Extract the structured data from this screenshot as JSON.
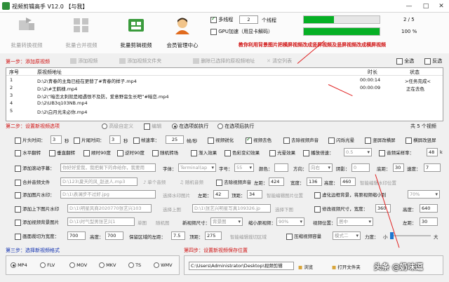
{
  "window": {
    "title": "视频剪辑高手 V12.0 【与我】",
    "minimize": "—",
    "maximize": "□",
    "close": "✕"
  },
  "toolbar": {
    "buttons": [
      "批量转换视频",
      "批量合并视频",
      "批量剪辑视频",
      "会员管理中心"
    ]
  },
  "threads": {
    "multi_label": "多线程",
    "count": "2",
    "unit": "个线程",
    "gpu_label": "GPU加速（用显卡解码）",
    "progress1": {
      "fraction": 0.4,
      "text": "2 / 5"
    },
    "progress2": {
      "fraction": 1.0,
      "text": "100 %"
    }
  },
  "banner": "教你利用背景图片把横屏视频改成竖屏视频及竖屏视频改成横屏视频",
  "step1": {
    "title": "第一步：添加原视频",
    "add_video": "添加视频",
    "add_folder": "添加视频文件夹",
    "remove_selected": "删除已选择的原视频地址",
    "clear_list": "清空列表",
    "select_all": "全选",
    "invert": "反选"
  },
  "table": {
    "headers": [
      "序号",
      "原视频地址",
      "时长",
      "状态"
    ],
    "rows": [
      {
        "no": "1",
        "path": "D:\\2\\青春的主角已经在更替了#青春的样子.mp4",
        "duration": "00:00:14",
        "status": ">任务完成<"
      },
      {
        "no": "2",
        "path": "D:\\2\\#王鹤棣.mp4",
        "duration": "00:00:09",
        "status": "正在去色"
      },
      {
        "no": "3",
        "path": "D:\\2\\“暗恋太刺就是相遇恨不及防，爱意野蛮生长吧”#暗恋.mp4",
        "duration": "",
        "status": ""
      },
      {
        "no": "4",
        "path": "D:\\2\\UB3q103NB.mp4",
        "duration": "",
        "status": ""
      },
      {
        "no": "5",
        "path": "D:\\2\\白月光未必你.mp4",
        "duration": "",
        "status": ""
      }
    ]
  },
  "step2": {
    "title": "第二步：设置新视频选项",
    "advanced": "高级自定义",
    "edit": "编辑",
    "parallel": "在选项前执行",
    "after": "在选项后执行",
    "total": "共 5 个视频"
  },
  "options": {
    "r1": {
      "head_cut": "片头时间：",
      "head_val": "3",
      "sec1": "秒",
      "tail_cut": "片尾时间：",
      "tail_val": "3",
      "sec2": "秒",
      "fps_label": "帧速率：",
      "fps_val": "25",
      "fps_unit": "帧/秒",
      "checks": [
        "视频锐化",
        "视频去色",
        "去除视频声音",
        "闪烁光晕",
        "竖屏改横屏",
        "横屏改竖屏"
      ]
    },
    "r2": {
      "checks": [
        "水平翻转",
        "垂直翻转",
        "顺时90度",
        "逆时90度",
        "随机转场",
        "渐入效果",
        "色彩变幻效果",
        "光晕效果",
        "播放倍速："
      ],
      "speed_val": "0.5",
      "sample_label": "音频采样率：",
      "sample_val": "48",
      "sample_unit": "k"
    },
    "r3": {
      "subtitle_label": "添加滚动字幕：",
      "subtitle_val": "你好好爱我，我把剩下的命给你，我要用",
      "font_label": "字体：",
      "font_val": "Terminal(ap",
      "size_label": "字号：",
      "size_val": "55",
      "color_label": "颜色：",
      "dir_label": "方向：",
      "dir_val": "向右",
      "shadow_label": "阴影：",
      "shadow_val": "0",
      "bottom_label": "底距：",
      "bottom_val": "30",
      "speed_label": "速度：",
      "speed_val": "7"
    },
    "r4": {
      "audio_label": "合并音频文件",
      "audio_val": "D:\\123\\夏天的风_赵送人.mp3",
      "single": "单个音频",
      "random": "随机音频",
      "bgm_label": "去除视频声音",
      "left_label": "左距：",
      "left_val": "424",
      "width_label": "宽度：",
      "width_val": "136",
      "height_label": "高度：",
      "height_val": "460",
      "smart_pos": "智能编辑水印位置"
    },
    "r5": {
      "img_wm_label": "添加图片水印：",
      "img_wm_val": "D:\\1\\表澜步不过好.jpg",
      "pick_img": "选择水印图片",
      "left_label": "左距：",
      "left_val": "42",
      "top_label": "顶距：",
      "top_val": "34",
      "smart_pos": "智能编辑图片位置",
      "blur_label": "虚化边框背景，将原视频缩小到",
      "blur_val": "70%"
    },
    "r6": {
      "head_tail_label": "添加上下图片水印",
      "head_tail_val": "D:\\1\\明星风商2020770张艺兴103",
      "pick_top": "选择上图",
      "bottom_val": "D:\\1\\张艺兴明星写真109326.jp",
      "pick_bottom": "选择下图",
      "resize_label": "修改视频尺寸，宽度：",
      "w_val": "360",
      "h_label": "高度：",
      "h_val": "640"
    },
    "r7": {
      "frame_label": "添加视频背景图片",
      "frame_val": "D:\\1\\时气型男张艺兴1",
      "single": "单图",
      "random": "随机图",
      "size_label": "新视频尺寸：",
      "size_val": "背景图",
      "shrink_label": "缩小原视频：",
      "shrink_val": "90%",
      "pos_label": "视频位置：",
      "pos_val": "居中",
      "left_label": "左距：",
      "left_val": "30"
    },
    "r8": {
      "crop_label": "画面裁切为宽度：",
      "crop_w": "700",
      "crop_h_label": "高度：",
      "crop_h": "700",
      "keep_label": "保留区域的左距：",
      "keep_val": "7.5",
      "top_label": "顶距：",
      "top_val": "275",
      "smart_crop": "智能编辑裁切区域",
      "quality_label": "压缩视频容量",
      "quality_val": "模式二",
      "force_label": "力度：",
      "small": "小",
      "large": "大"
    }
  },
  "step3": {
    "title": "第三步：选择新视频格式",
    "formats": [
      "MP4",
      "FLV",
      "MOV",
      "MKV",
      "TS",
      "WMV"
    ]
  },
  "step4": {
    "title": "第四步：设置新视频保存位置",
    "path": "C:\\Users\\Administrator\\Desktop\\视频剪辑",
    "browse": "浏览",
    "open": "打开文件夹"
  },
  "watermark": "头条 @奶味逗"
}
